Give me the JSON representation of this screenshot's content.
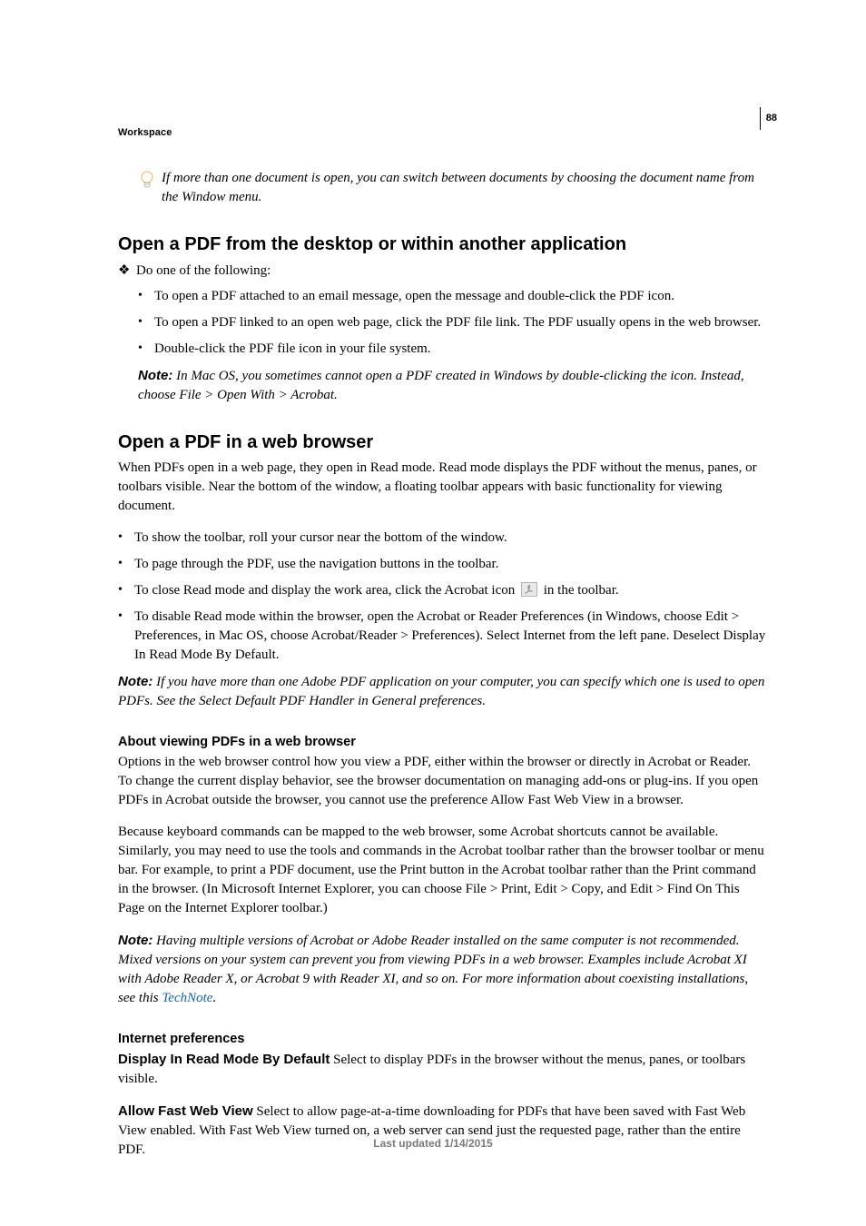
{
  "header": {
    "breadcrumb": "Workspace",
    "page_number": "88"
  },
  "tip": {
    "text": "If more than one document is open, you can switch between documents by choosing the document name from the Window menu."
  },
  "section1": {
    "heading": "Open a PDF from the desktop or within another application",
    "lead": "Do one of the following:",
    "items": [
      "To open a PDF attached to an email message, open the message and double-click the PDF icon.",
      "To open a PDF linked to an open web page, click the PDF file link. The PDF usually opens in the web browser.",
      "Double-click the PDF file icon in your file system."
    ],
    "note_label": "Note:",
    "note_text": " In Mac OS, you sometimes cannot open a PDF created in Windows by double-clicking the icon. Instead, choose File > Open With > Acrobat."
  },
  "section2": {
    "heading": "Open a PDF in a web browser",
    "intro": "When PDFs open in a web page, they open in Read mode. Read mode displays the PDF without the menus, panes, or toolbars visible. Near the bottom of the window, a floating toolbar appears with basic functionality for viewing document.",
    "items": {
      "i0": "To show the toolbar, roll your cursor near the bottom of the window.",
      "i1": "To page through the PDF, use the navigation buttons in the toolbar.",
      "i2a": "To close Read mode and display the work area, click the Acrobat icon ",
      "i2b": " in the toolbar.",
      "i3": "To disable Read mode within the browser, open the Acrobat or Reader Preferences (in Windows, choose Edit > Preferences, in Mac OS, choose Acrobat/Reader > Preferences). Select Internet from the left pane. Deselect Display In Read Mode By Default."
    },
    "note_label": "Note:",
    "note_text": " If you have more than one Adobe PDF application on your computer, you can specify which one is used to open PDFs. See the Select Default PDF Handler in General preferences."
  },
  "section3": {
    "heading": "About viewing PDFs in a web browser",
    "para1": "Options in the web browser control how you view a PDF, either within the browser or directly in Acrobat or Reader. To change the current display behavior, see the browser documentation on managing add-ons or plug-ins. If you open PDFs in Acrobat outside the browser, you cannot use the preference Allow Fast Web View in a browser.",
    "para2": "Because keyboard commands can be mapped to the web browser, some Acrobat shortcuts cannot be available. Similarly, you may need to use the tools and commands in the Acrobat toolbar rather than the browser toolbar or menu bar. For example, to print a PDF document, use the Print button in the Acrobat toolbar rather than the Print command in the browser. (In Microsoft Internet Explorer, you can choose File > Print, Edit > Copy, and Edit > Find On This Page on the Internet Explorer toolbar.)",
    "note_label": "Note:",
    "note_text_a": " Having multiple versions of Acrobat or Adobe Reader installed on the same computer is not recommended. Mixed versions on your system can prevent you from viewing PDFs in a web browser. Examples include Acrobat XI with Adobe Reader X, or Acrobat 9 with Reader XI, and so on. For more information about coexisting installations, see this ",
    "note_link": "TechNote",
    "note_text_b": "."
  },
  "section4": {
    "heading": "Internet preferences",
    "pref1_label": "Display In Read Mode By Default",
    "pref1_text": "  Select to display PDFs in the browser without the menus, panes, or toolbars visible.",
    "pref2_label": "Allow Fast Web View",
    "pref2_text": "  Select to allow page-at-a-time downloading for PDFs that have been saved with Fast Web View enabled. With Fast Web View turned on, a web server can send just the requested page, rather than the entire PDF."
  },
  "footer": {
    "text": "Last updated 1/14/2015"
  }
}
